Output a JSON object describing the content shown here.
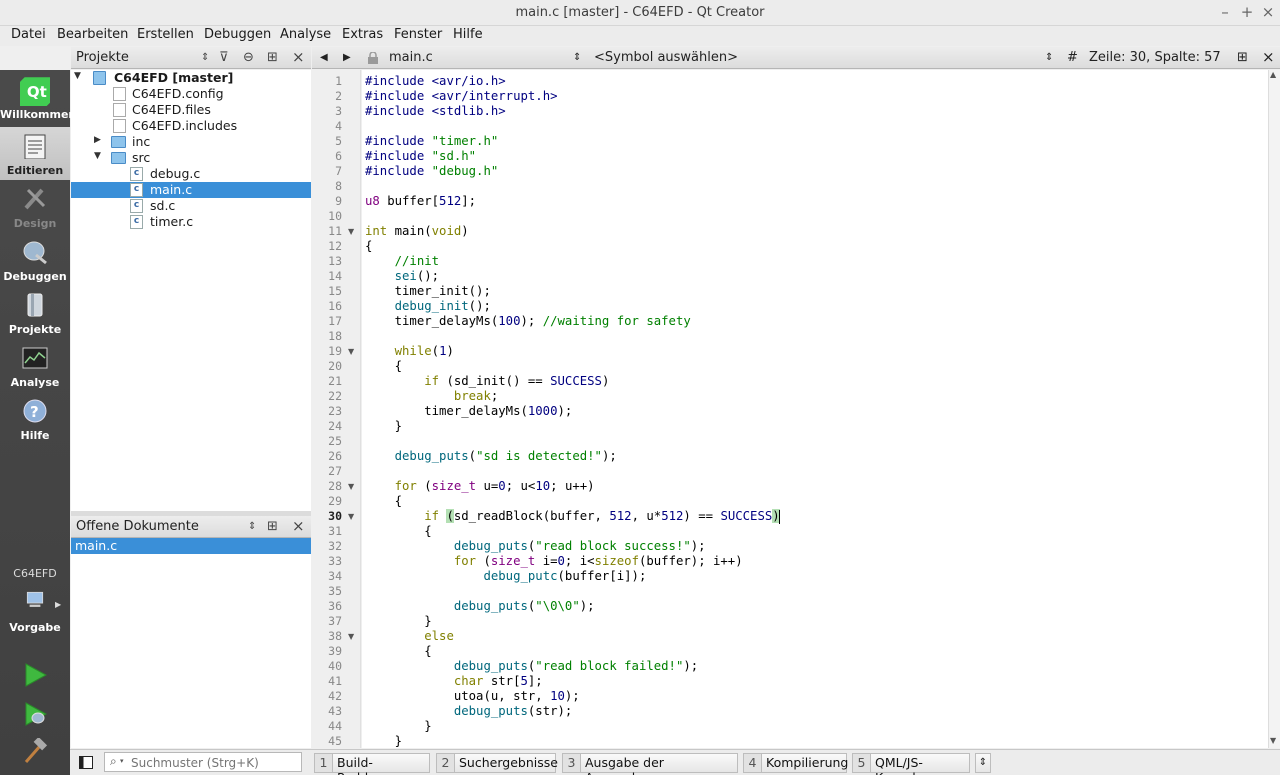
{
  "window": {
    "title": "main.c [master] - C64EFD - Qt Creator"
  },
  "menu": [
    "Datei",
    "Bearbeiten",
    "Erstellen",
    "Debuggen",
    "Analyse",
    "Extras",
    "Fenster",
    "Hilfe"
  ],
  "modes": [
    {
      "label": "Willkommen",
      "icon": "qt-logo-icon"
    },
    {
      "label": "Editieren",
      "icon": "edit-document-icon"
    },
    {
      "label": "Design",
      "icon": "design-pencil-icon"
    },
    {
      "label": "Debuggen",
      "icon": "debug-bug-icon"
    },
    {
      "label": "Projekte",
      "icon": "projects-icon"
    },
    {
      "label": "Analyse",
      "icon": "analyze-icon"
    },
    {
      "label": "Hilfe",
      "icon": "help-icon"
    }
  ],
  "kit": {
    "name": "C64EFD",
    "target": "Vorgabe"
  },
  "projects": {
    "header": "Projekte",
    "tree": [
      {
        "label": "C64EFD [master]",
        "kind": "project"
      },
      {
        "label": "C64EFD.config",
        "kind": "file"
      },
      {
        "label": "C64EFD.files",
        "kind": "file"
      },
      {
        "label": "C64EFD.includes",
        "kind": "file"
      },
      {
        "label": "inc",
        "kind": "folder"
      },
      {
        "label": "src",
        "kind": "folder"
      },
      {
        "label": "debug.c",
        "kind": "cfile"
      },
      {
        "label": "main.c",
        "kind": "cfile",
        "selected": true
      },
      {
        "label": "sd.c",
        "kind": "cfile"
      },
      {
        "label": "timer.c",
        "kind": "cfile"
      }
    ]
  },
  "open_documents": {
    "header": "Offene Dokumente",
    "items": [
      "main.c"
    ]
  },
  "editor": {
    "file": "main.c",
    "symbol": "<Symbol auswählen>",
    "hash": "#",
    "position": "Zeile: 30, Spalte: 57",
    "current_line": 30,
    "lines": [
      "#include <avr/io.h>",
      "#include <avr/interrupt.h>",
      "#include <stdlib.h>",
      "",
      "#include \"timer.h\"",
      "#include \"sd.h\"",
      "#include \"debug.h\"",
      "",
      "u8 buffer[512];",
      "",
      "int main(void)",
      "{",
      "    //init",
      "    sei();",
      "    timer_init();",
      "    debug_init();",
      "    timer_delayMs(100); //waiting for safety",
      "",
      "    while(1)",
      "    {",
      "        if (sd_init() == SUCCESS)",
      "            break;",
      "        timer_delayMs(1000);",
      "    }",
      "",
      "    debug_puts(\"sd is detected!\");",
      "",
      "    for (size_t u=0; u<10; u++)",
      "    {",
      "        if (sd_readBlock(buffer, 512, u*512) == SUCCESS)",
      "        {",
      "            debug_puts(\"read block success!\");",
      "            for (size_t i=0; i<sizeof(buffer); i++)",
      "                debug_putc(buffer[i]);",
      "",
      "            debug_puts(\"\\0\\0\");",
      "        }",
      "        else",
      "        {",
      "            debug_puts(\"read block failed!\");",
      "            char str[5];",
      "            utoa(u, str, 10);",
      "            debug_puts(str);",
      "        }",
      "    }"
    ],
    "fold_lines": [
      11,
      19,
      28,
      30,
      38
    ]
  },
  "locator": {
    "placeholder": "Suchmuster (Strg+K)"
  },
  "output_panes": [
    {
      "num": "1",
      "label": "Build-Probleme"
    },
    {
      "num": "2",
      "label": "Suchergebnisse"
    },
    {
      "num": "3",
      "label": "Ausgabe der Anwendung"
    },
    {
      "num": "4",
      "label": "Kompilierung"
    },
    {
      "num": "5",
      "label": "QML/JS-Konsole"
    }
  ]
}
